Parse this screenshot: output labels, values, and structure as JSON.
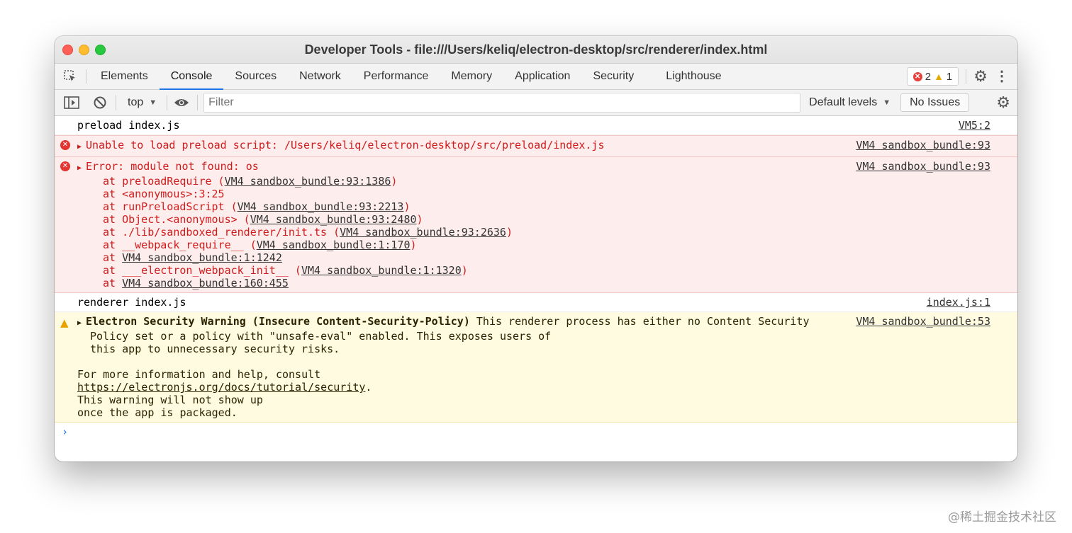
{
  "window": {
    "title": "Developer Tools - file:///Users/keliq/electron-desktop/src/renderer/index.html"
  },
  "tabs": [
    "Elements",
    "Console",
    "Sources",
    "Network",
    "Performance",
    "Memory",
    "Application",
    "Security",
    "Lighthouse"
  ],
  "active_tab": "Console",
  "status": {
    "error_count": "2",
    "warning_count": "1"
  },
  "toolbar": {
    "context": "top",
    "filter_placeholder": "Filter",
    "levels": "Default levels",
    "issues": "No Issues"
  },
  "messages": {
    "m1": {
      "text": "preload index.js",
      "source": "VM5:2"
    },
    "m2": {
      "text": "Unable to load preload script: /Users/keliq/electron-desktop/src/preload/index.js",
      "source": "VM4 sandbox_bundle:93"
    },
    "m3": {
      "text": "Error: module not found: os",
      "source": "VM4 sandbox_bundle:93",
      "stack": [
        {
          "prefix": "at preloadRequire (",
          "link": "VM4 sandbox_bundle:93:1386",
          "suffix": ")"
        },
        {
          "prefix": "at <anonymous>:3:25",
          "link": "",
          "suffix": ""
        },
        {
          "prefix": "at runPreloadScript (",
          "link": "VM4 sandbox_bundle:93:2213",
          "suffix": ")"
        },
        {
          "prefix": "at Object.<anonymous> (",
          "link": "VM4 sandbox_bundle:93:2480",
          "suffix": ")"
        },
        {
          "prefix": "at ./lib/sandboxed_renderer/init.ts (",
          "link": "VM4 sandbox_bundle:93:2636",
          "suffix": ")"
        },
        {
          "prefix": "at __webpack_require__ (",
          "link": "VM4 sandbox_bundle:1:170",
          "suffix": ")"
        },
        {
          "prefix": "at ",
          "link": "VM4 sandbox_bundle:1:1242",
          "suffix": ""
        },
        {
          "prefix": "at ___electron_webpack_init__ (",
          "link": "VM4 sandbox_bundle:1:1320",
          "suffix": ")"
        },
        {
          "prefix": "at ",
          "link": "VM4 sandbox_bundle:160:455",
          "suffix": ""
        }
      ]
    },
    "m4": {
      "text": "renderer index.js",
      "source": "index.js:1"
    },
    "m5": {
      "bold": "Electron Security Warning (Insecure Content-Security-Policy)",
      "line1": " This renderer process has either no Content Security",
      "line2": "Policy set or a policy with \"unsafe-eval\" enabled. This exposes users of",
      "line3": "this app to unnecessary security risks.",
      "line4": "For more information and help, consult",
      "link": "https://electronjs.org/docs/tutorial/security",
      "link_suffix": ".",
      "line5": "This warning will not show up",
      "line6": "once the app is packaged.",
      "source": "VM4 sandbox_bundle:53"
    }
  },
  "prompt": "›",
  "watermark": "@稀土掘金技术社区"
}
